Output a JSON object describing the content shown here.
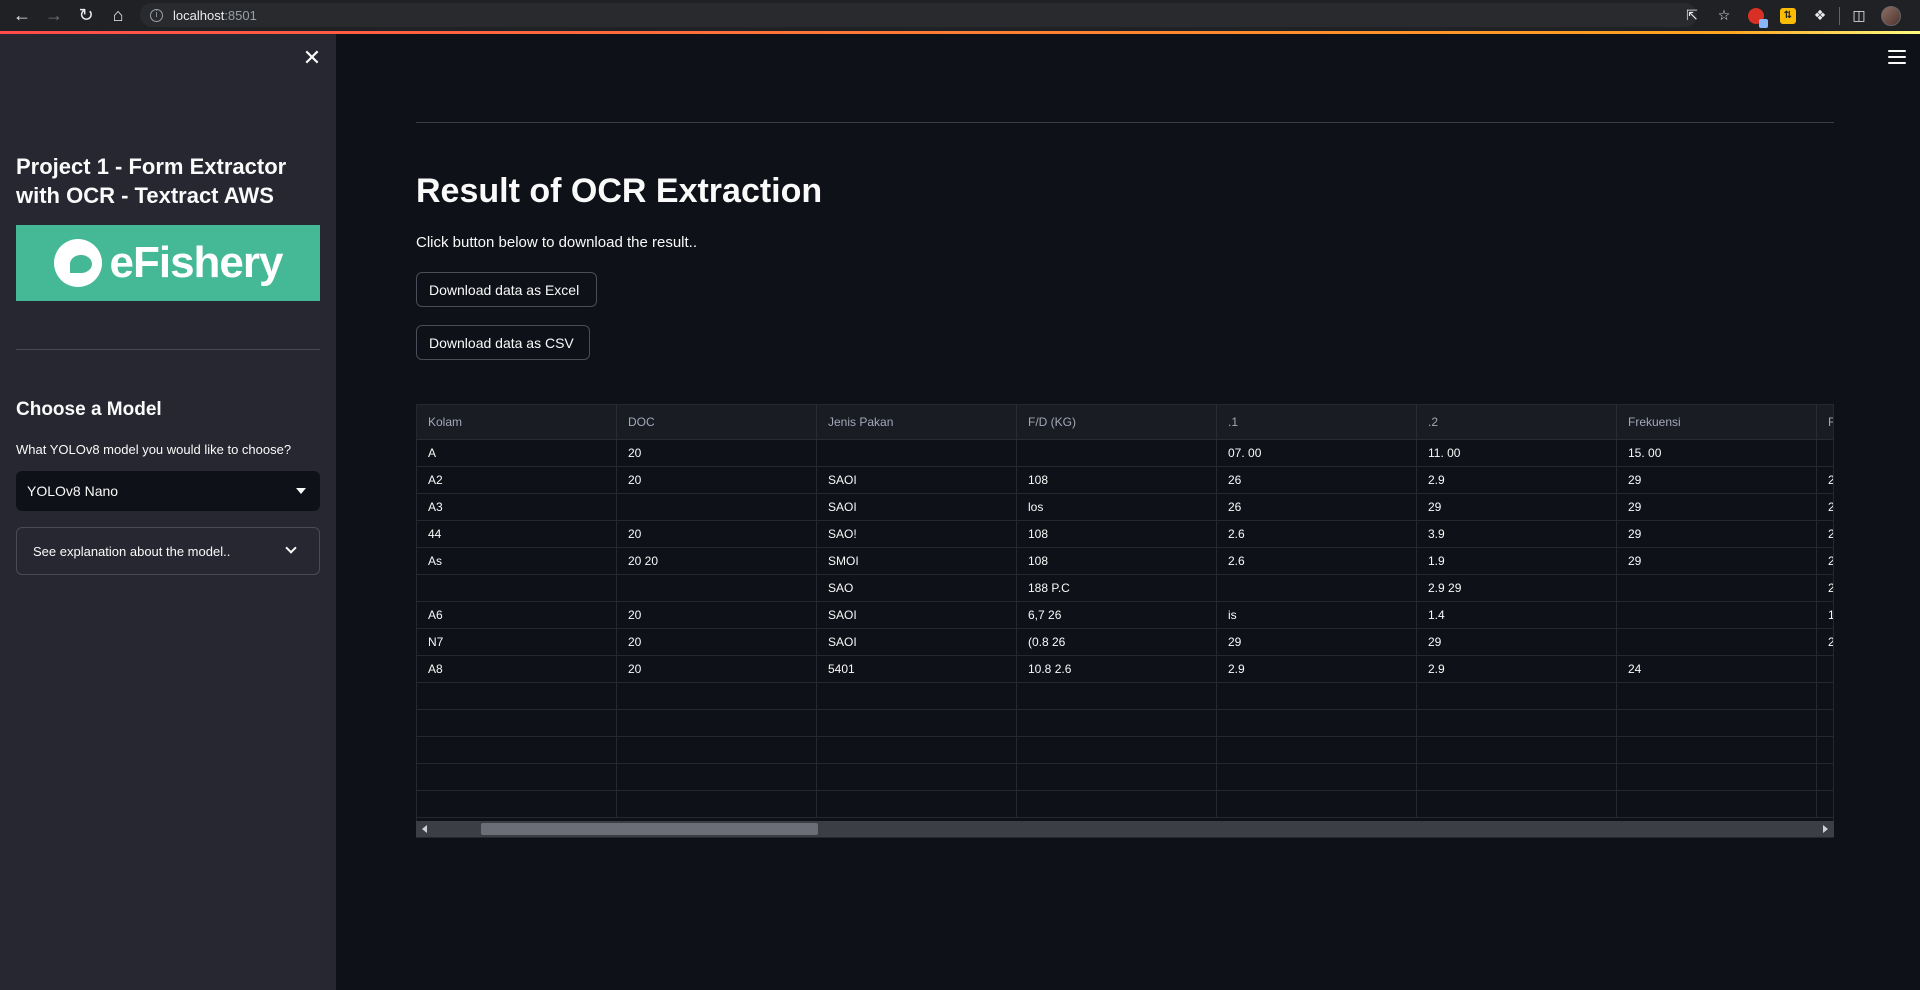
{
  "browser": {
    "url_host": "localhost",
    "url_port": ":8501"
  },
  "sidebar": {
    "title": "Project 1 - Form Extractor with OCR - Textract AWS",
    "logo_text": "eFishery",
    "section_heading": "Choose a Model",
    "select_label": "What YOLOv8 model you would like to choose?",
    "select_value": "YOLOv8 Nano",
    "expander_label": "See explanation about the model.."
  },
  "main": {
    "title": "Result of OCR Extraction",
    "description": "Click button below to download the result..",
    "download_excel_label": "Download data as Excel",
    "download_csv_label": "Download data as CSV"
  },
  "table": {
    "columns": [
      "Kolam",
      "DOC",
      "Jenis Pakan",
      "F/D (KG)",
      ".1",
      ".2",
      "Frekuensi",
      "F"
    ],
    "rows": [
      [
        "A",
        "20",
        "",
        "",
        "07. 00",
        "11. 00",
        "15. 00",
        ""
      ],
      [
        "A2",
        "20",
        "SAOI",
        "108",
        "26",
        "2.9",
        "29",
        "2"
      ],
      [
        "A3",
        "",
        "SAOI",
        "los",
        "26",
        "29",
        "29",
        "2"
      ],
      [
        "44",
        "20",
        "SAO!",
        "108",
        "2.6",
        "3.9",
        "29",
        "2"
      ],
      [
        "As",
        "20 20",
        "SMOI",
        "108",
        "2.6",
        "1.9",
        "29",
        "2"
      ],
      [
        "",
        "",
        "SAO",
        "188 P.C",
        "",
        "2.9 29",
        "",
        "2"
      ],
      [
        "A6",
        "20",
        "SAOI",
        "6,7 26",
        "is",
        "1.4",
        "",
        "1"
      ],
      [
        "N7",
        "20",
        "SAOI",
        "(0.8 26",
        "29",
        "29",
        "",
        "2"
      ],
      [
        "A8",
        "20",
        "5401",
        "10.8 2.6",
        "2.9",
        "2.9",
        "24",
        ""
      ],
      [
        "",
        "",
        "",
        "",
        "",
        "",
        "",
        ""
      ],
      [
        "",
        "",
        "",
        "",
        "",
        "",
        "",
        ""
      ],
      [
        "",
        "",
        "",
        "",
        "",
        "",
        "",
        ""
      ],
      [
        "",
        "",
        "",
        "",
        "",
        "",
        "",
        ""
      ],
      [
        "",
        "",
        "",
        "",
        "",
        "",
        "",
        ""
      ]
    ]
  },
  "colors": {
    "background": "#0e1117",
    "sidebar": "#262730",
    "logo_green": "#45b896"
  }
}
